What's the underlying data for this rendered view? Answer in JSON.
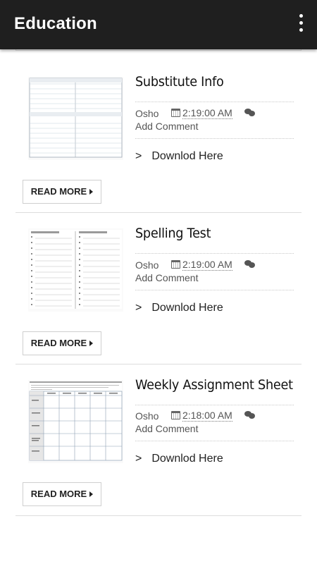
{
  "app_bar": {
    "title": "Education",
    "menu_icon": "more-vert-icon"
  },
  "posts": [
    {
      "title": "Substitute Info",
      "author": "Osho",
      "time": "2:19:00 AM",
      "comment_link": "Add Comment",
      "download_prefix": ">",
      "download_label": "Downlod Here",
      "read_more": "READ MORE"
    },
    {
      "title": "Spelling Test",
      "author": "Osho",
      "time": "2:19:00 AM",
      "comment_link": "Add Comment",
      "download_prefix": ">",
      "download_label": "Downlod Here",
      "read_more": "READ MORE"
    },
    {
      "title": "Weekly Assignment Sheet",
      "author": "Osho",
      "time": "2:18:00 AM",
      "comment_link": "Add Comment",
      "download_prefix": ">",
      "download_label": "Downlod Here",
      "read_more": "READ MORE"
    }
  ],
  "icons": {
    "date": "calendar-icon",
    "comments": "comments-icon",
    "read_more_arrow": "caret-right-icon"
  },
  "colors": {
    "app_bar": "#1f1f1f",
    "text_primary": "#111111",
    "text_meta": "#555555",
    "divider": "#dcdcdc"
  }
}
